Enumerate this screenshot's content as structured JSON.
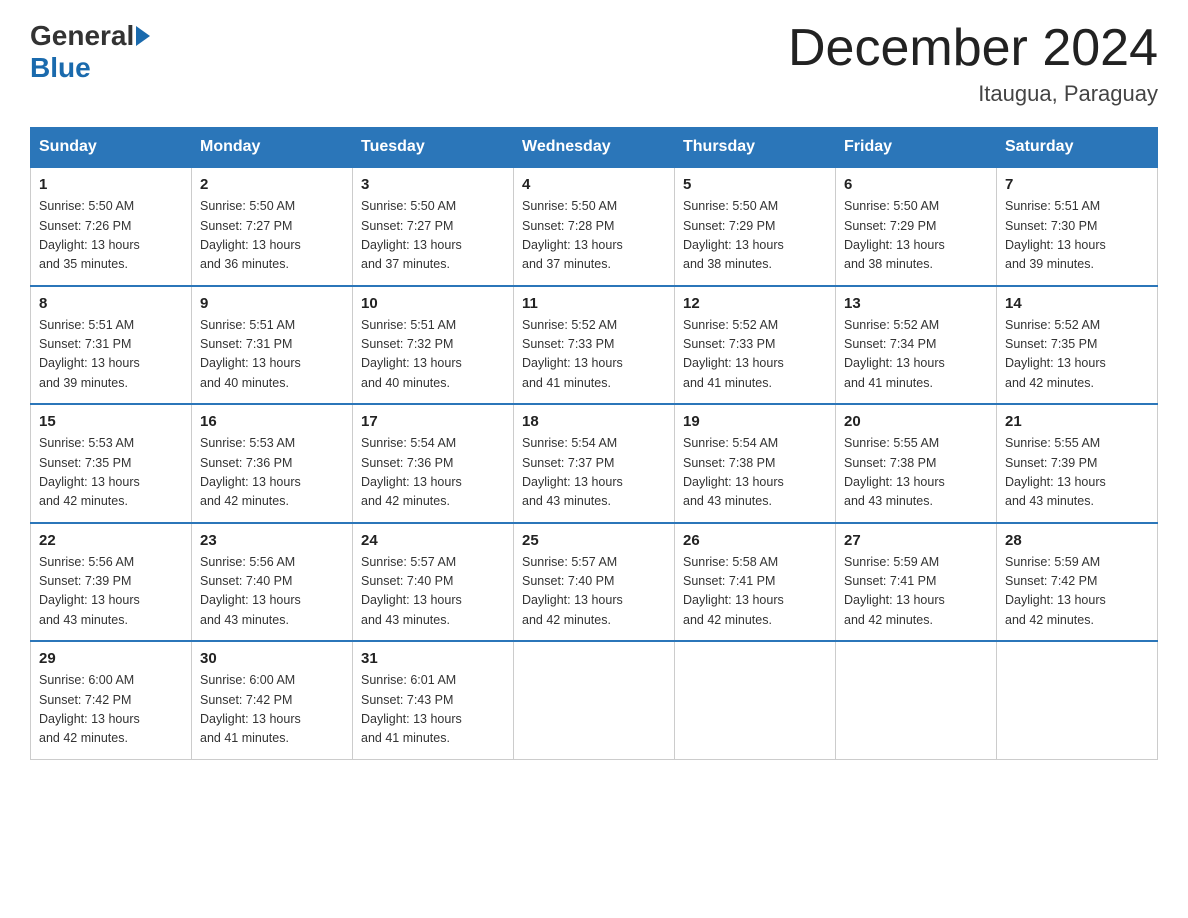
{
  "logo": {
    "general": "General",
    "blue": "Blue"
  },
  "title": "December 2024",
  "location": "Itaugua, Paraguay",
  "headers": [
    "Sunday",
    "Monday",
    "Tuesday",
    "Wednesday",
    "Thursday",
    "Friday",
    "Saturday"
  ],
  "weeks": [
    [
      {
        "day": "1",
        "sunrise": "5:50 AM",
        "sunset": "7:26 PM",
        "daylight": "13 hours and 35 minutes."
      },
      {
        "day": "2",
        "sunrise": "5:50 AM",
        "sunset": "7:27 PM",
        "daylight": "13 hours and 36 minutes."
      },
      {
        "day": "3",
        "sunrise": "5:50 AM",
        "sunset": "7:27 PM",
        "daylight": "13 hours and 37 minutes."
      },
      {
        "day": "4",
        "sunrise": "5:50 AM",
        "sunset": "7:28 PM",
        "daylight": "13 hours and 37 minutes."
      },
      {
        "day": "5",
        "sunrise": "5:50 AM",
        "sunset": "7:29 PM",
        "daylight": "13 hours and 38 minutes."
      },
      {
        "day": "6",
        "sunrise": "5:50 AM",
        "sunset": "7:29 PM",
        "daylight": "13 hours and 38 minutes."
      },
      {
        "day": "7",
        "sunrise": "5:51 AM",
        "sunset": "7:30 PM",
        "daylight": "13 hours and 39 minutes."
      }
    ],
    [
      {
        "day": "8",
        "sunrise": "5:51 AM",
        "sunset": "7:31 PM",
        "daylight": "13 hours and 39 minutes."
      },
      {
        "day": "9",
        "sunrise": "5:51 AM",
        "sunset": "7:31 PM",
        "daylight": "13 hours and 40 minutes."
      },
      {
        "day": "10",
        "sunrise": "5:51 AM",
        "sunset": "7:32 PM",
        "daylight": "13 hours and 40 minutes."
      },
      {
        "day": "11",
        "sunrise": "5:52 AM",
        "sunset": "7:33 PM",
        "daylight": "13 hours and 41 minutes."
      },
      {
        "day": "12",
        "sunrise": "5:52 AM",
        "sunset": "7:33 PM",
        "daylight": "13 hours and 41 minutes."
      },
      {
        "day": "13",
        "sunrise": "5:52 AM",
        "sunset": "7:34 PM",
        "daylight": "13 hours and 41 minutes."
      },
      {
        "day": "14",
        "sunrise": "5:52 AM",
        "sunset": "7:35 PM",
        "daylight": "13 hours and 42 minutes."
      }
    ],
    [
      {
        "day": "15",
        "sunrise": "5:53 AM",
        "sunset": "7:35 PM",
        "daylight": "13 hours and 42 minutes."
      },
      {
        "day": "16",
        "sunrise": "5:53 AM",
        "sunset": "7:36 PM",
        "daylight": "13 hours and 42 minutes."
      },
      {
        "day": "17",
        "sunrise": "5:54 AM",
        "sunset": "7:36 PM",
        "daylight": "13 hours and 42 minutes."
      },
      {
        "day": "18",
        "sunrise": "5:54 AM",
        "sunset": "7:37 PM",
        "daylight": "13 hours and 43 minutes."
      },
      {
        "day": "19",
        "sunrise": "5:54 AM",
        "sunset": "7:38 PM",
        "daylight": "13 hours and 43 minutes."
      },
      {
        "day": "20",
        "sunrise": "5:55 AM",
        "sunset": "7:38 PM",
        "daylight": "13 hours and 43 minutes."
      },
      {
        "day": "21",
        "sunrise": "5:55 AM",
        "sunset": "7:39 PM",
        "daylight": "13 hours and 43 minutes."
      }
    ],
    [
      {
        "day": "22",
        "sunrise": "5:56 AM",
        "sunset": "7:39 PM",
        "daylight": "13 hours and 43 minutes."
      },
      {
        "day": "23",
        "sunrise": "5:56 AM",
        "sunset": "7:40 PM",
        "daylight": "13 hours and 43 minutes."
      },
      {
        "day": "24",
        "sunrise": "5:57 AM",
        "sunset": "7:40 PM",
        "daylight": "13 hours and 43 minutes."
      },
      {
        "day": "25",
        "sunrise": "5:57 AM",
        "sunset": "7:40 PM",
        "daylight": "13 hours and 42 minutes."
      },
      {
        "day": "26",
        "sunrise": "5:58 AM",
        "sunset": "7:41 PM",
        "daylight": "13 hours and 42 minutes."
      },
      {
        "day": "27",
        "sunrise": "5:59 AM",
        "sunset": "7:41 PM",
        "daylight": "13 hours and 42 minutes."
      },
      {
        "day": "28",
        "sunrise": "5:59 AM",
        "sunset": "7:42 PM",
        "daylight": "13 hours and 42 minutes."
      }
    ],
    [
      {
        "day": "29",
        "sunrise": "6:00 AM",
        "sunset": "7:42 PM",
        "daylight": "13 hours and 42 minutes."
      },
      {
        "day": "30",
        "sunrise": "6:00 AM",
        "sunset": "7:42 PM",
        "daylight": "13 hours and 41 minutes."
      },
      {
        "day": "31",
        "sunrise": "6:01 AM",
        "sunset": "7:43 PM",
        "daylight": "13 hours and 41 minutes."
      },
      null,
      null,
      null,
      null
    ]
  ],
  "labels": {
    "sunrise": "Sunrise:",
    "sunset": "Sunset:",
    "daylight": "Daylight:"
  }
}
